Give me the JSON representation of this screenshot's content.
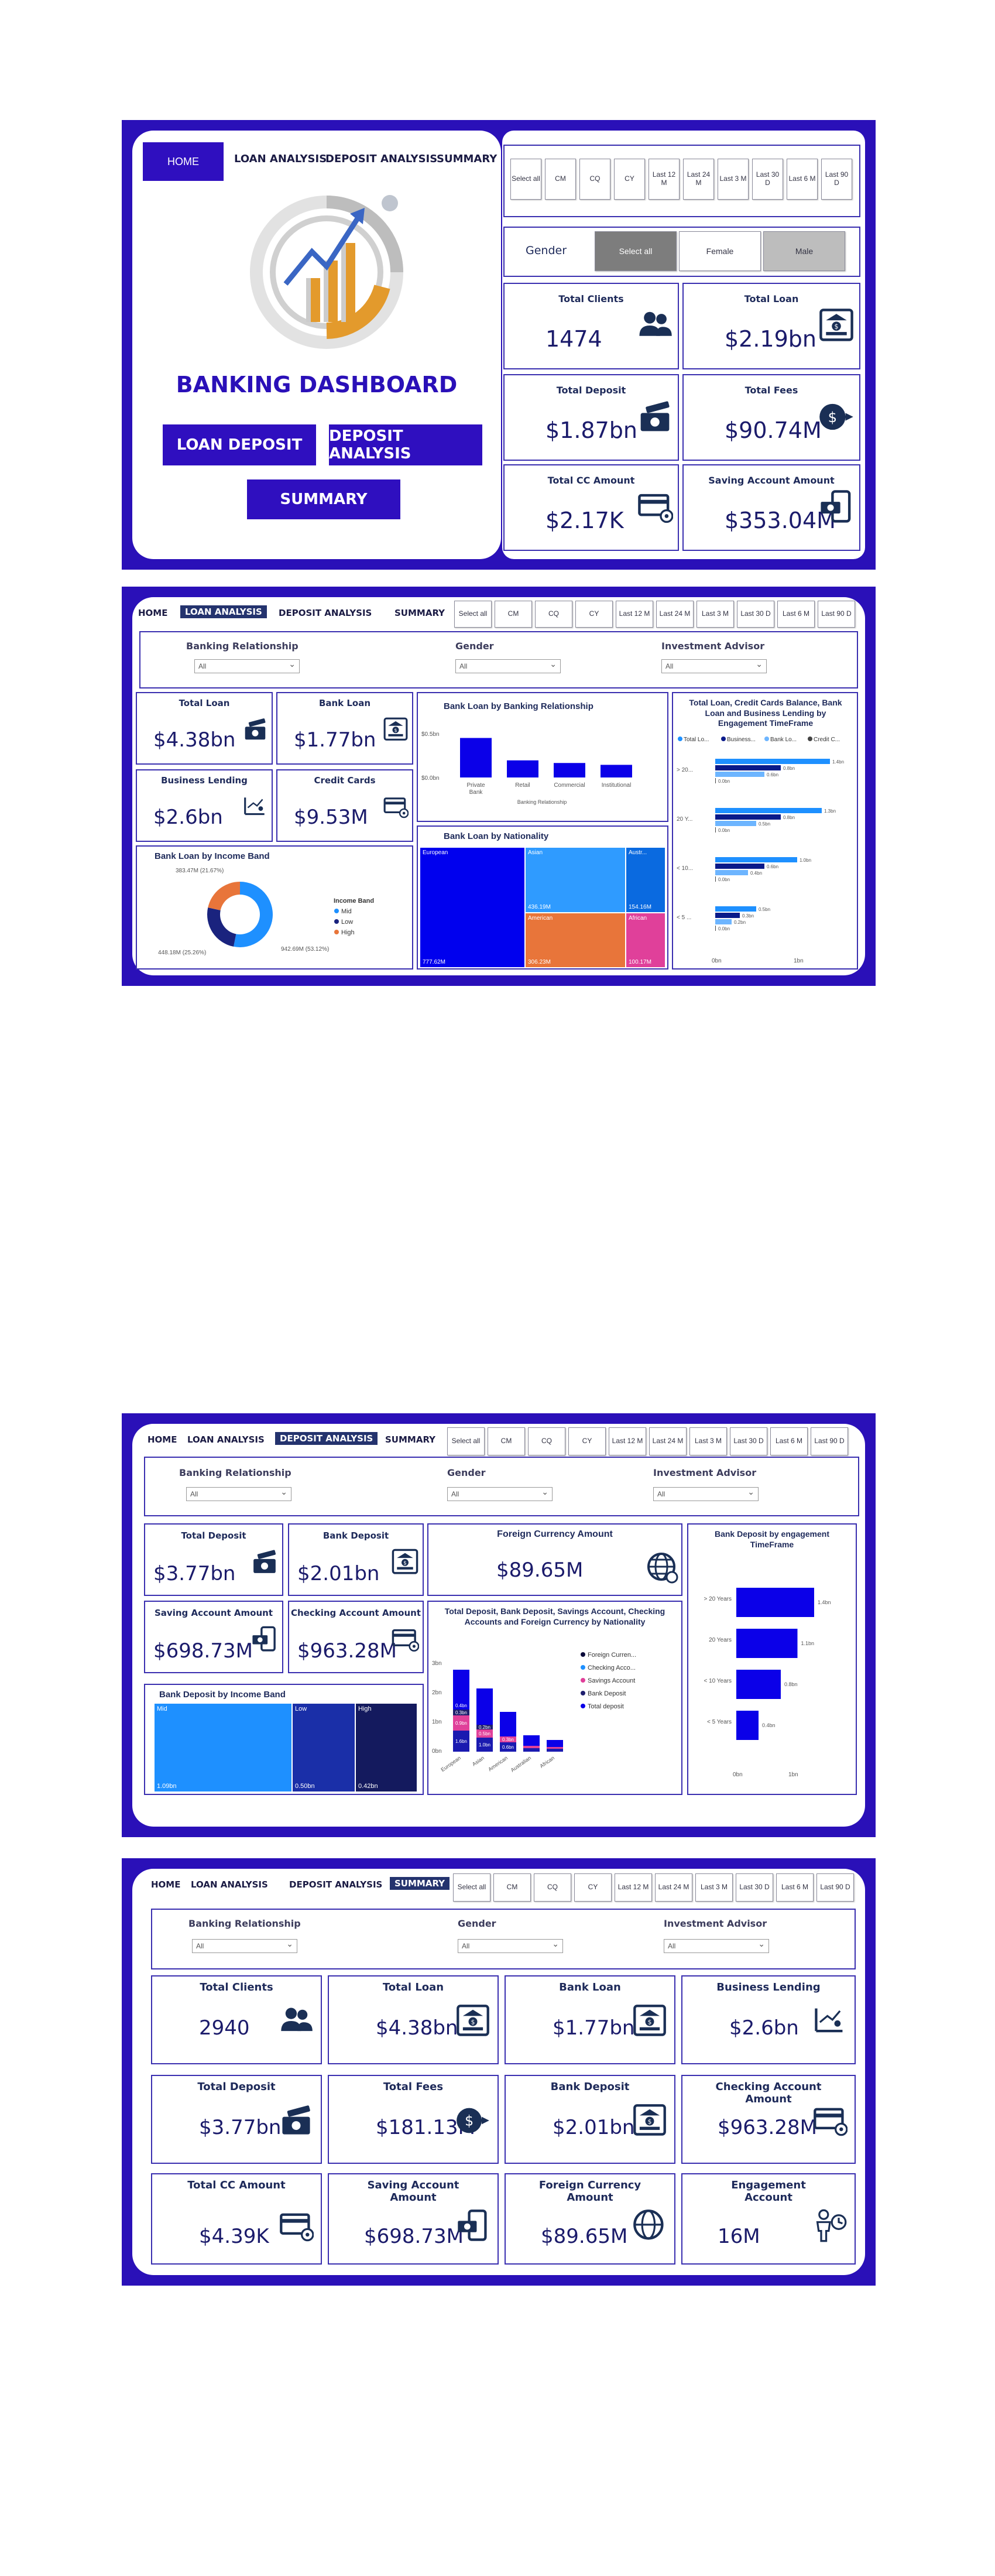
{
  "nav": {
    "home": "HOME",
    "loan": "LOAN ANALYSIS",
    "deposit": "DEPOSIT ANALYSIS",
    "summary": "SUMMARY"
  },
  "time_buttons": [
    "Select all",
    "CM",
    "CQ",
    "CY",
    "Last 12 M",
    "Last 24 M",
    "Last 3 M",
    "Last 30 D",
    "Last 6 M",
    "Last 90 D"
  ],
  "slicers": {
    "banking_relationship": "Banking Relationship",
    "gender": "Gender",
    "investment_advisor": "Investment Advisor",
    "all": "All"
  },
  "home": {
    "title": "BANKING DASHBOARD",
    "buttons": {
      "loan_deposit": "LOAN DEPOSIT",
      "deposit_analysis": "DEPOSIT ANALYSIS",
      "summary": "SUMMARY"
    },
    "gender": {
      "label": "Gender",
      "options": [
        "Select all",
        "Female",
        "Male"
      ]
    },
    "kpis": [
      {
        "title": "Total Clients",
        "value": "1474",
        "icon": "people-icon"
      },
      {
        "title": "Total Loan",
        "value": "$2.19bn",
        "icon": "bank-icon"
      },
      {
        "title": "Total Deposit",
        "value": "$1.87bn",
        "icon": "cash-icon"
      },
      {
        "title": "Total Fees",
        "value": "$90.74M",
        "icon": "dollar-arrow-icon"
      },
      {
        "title": "Total CC Amount",
        "value": "$2.17K",
        "icon": "credit-card-icon"
      },
      {
        "title": "Saving Account Amount",
        "value": "$353.04M",
        "icon": "savings-phone-icon"
      }
    ]
  },
  "loan": {
    "kpis": [
      {
        "title": "Total Loan",
        "value": "$4.38bn"
      },
      {
        "title": "Bank Loan",
        "value": "$1.77bn"
      },
      {
        "title": "Business Lending",
        "value": "$2.6bn"
      },
      {
        "title": "Credit Cards",
        "value": "$9.53M"
      }
    ],
    "income_band": {
      "title": "Bank Loan by Income Band",
      "legend_title": "Income Band",
      "labels": [
        "Mid",
        "Low",
        "High"
      ],
      "annotations": [
        "383.47M (21.67%)",
        "448.18M (25.26%)",
        "942.69M (53.12%)"
      ],
      "colors": [
        "#1e90ff",
        "#1a237e",
        "#e8753a"
      ],
      "values": [
        942.69,
        448.18,
        383.47
      ]
    },
    "relationship": {
      "title": "Bank Loan by  Banking Relationship",
      "categories": [
        "Private Bank",
        "Retail",
        "Commercial",
        "Institutional"
      ],
      "values": [
        1.5,
        0.65,
        0.55,
        0.48
      ],
      "ticks": [
        "$1.0bn",
        "$0.5bn",
        "$0.0bn"
      ],
      "xlabel": "Banking Relationship"
    },
    "nationality": {
      "title": "Bank Loan by  Nationality",
      "tiles": [
        {
          "name": "European",
          "value": "777.62M",
          "color": "#0000ee"
        },
        {
          "name": "Asian",
          "value": "436.19M",
          "color": "#2f9bff"
        },
        {
          "name": "Austr...",
          "value": "154.16M",
          "color": "#0a6ae0"
        },
        {
          "name": "American",
          "value": "306.23M",
          "color": "#e8753a"
        },
        {
          "name": "African",
          "value": "100.17M",
          "color": "#e0409a"
        }
      ]
    },
    "timeframe": {
      "title": "Total Loan, Credit Cards Balance, Bank Loan and Business Lending by Engagement TimeFrame",
      "legend": [
        "Total Lo...",
        "Business...",
        "Bank Lo...",
        "Credit C..."
      ],
      "groups": [
        "> 20...",
        "20 Y...",
        "< 10...",
        "< 5 ..."
      ],
      "labels": [
        [
          "1.4bn",
          "0.8bn",
          "0.6bn",
          "0.0bn"
        ],
        [
          "1.3bn",
          "0.8bn",
          "0.5bn",
          "0.0bn"
        ],
        [
          "1.0bn",
          "0.6bn",
          "0.4bn",
          "0.0bn"
        ],
        [
          "0.5bn",
          "0.3bn",
          "0.2bn",
          "0.0bn"
        ]
      ],
      "values": [
        [
          1.4,
          0.8,
          0.6,
          0.0
        ],
        [
          1.3,
          0.8,
          0.5,
          0.0
        ],
        [
          1.0,
          0.6,
          0.4,
          0.0
        ],
        [
          0.5,
          0.3,
          0.2,
          0.0
        ]
      ],
      "axis": [
        "0bn",
        "1bn"
      ]
    }
  },
  "deposit": {
    "kpis": [
      {
        "title": "Total Deposit",
        "value": "$3.77bn"
      },
      {
        "title": "Bank Deposit",
        "value": "$2.01bn"
      },
      {
        "title": "Saving Account Amount",
        "value": "$698.73M"
      },
      {
        "title": "Checking Account Amount",
        "value": "$963.28M"
      }
    ],
    "fx": {
      "title": "Foreign Currency Amount",
      "value": "$89.65M"
    },
    "income_band": {
      "title": "Bank Deposit by Income Band",
      "tiles": [
        {
          "name": "Mid",
          "value": "1.09bn"
        },
        {
          "name": "Low",
          "value": "0.50bn"
        },
        {
          "name": "High",
          "value": "0.42bn"
        }
      ]
    },
    "stacked": {
      "title": "Total Deposit, Bank Deposit, Savings Account, Checking Accounts and Foreign Currency by Nationality",
      "legend": [
        "Foreign Curren...",
        "Checking Acco...",
        "Savings Account",
        "Bank Deposit",
        "Total deposit"
      ],
      "categories": [
        "European",
        "Asian",
        "American",
        "Australian",
        "African"
      ],
      "labels": [
        [
          "1.6bn",
          "0.9bn",
          "0.3bn",
          "0.4bn"
        ],
        [
          "1.0bn",
          "0.5bn",
          "0.2bn"
        ],
        [
          "0.6bn",
          "0.3bn"
        ],
        [
          "",
          ""
        ],
        [
          "",
          ""
        ]
      ],
      "ticks": [
        "3bn",
        "2bn",
        "1bn",
        "0bn"
      ]
    },
    "timeframe": {
      "title": "Bank Deposit by engagement TimeFrame",
      "categories": [
        "> 20 Years",
        "20 Years",
        "< 10 Years",
        "< 5 Years"
      ],
      "values": [
        1.4,
        1.1,
        0.8,
        0.4
      ],
      "labels": [
        "1.4bn",
        "1.1bn",
        "0.8bn",
        "0.4bn"
      ],
      "axis": [
        "0bn",
        "1bn"
      ]
    }
  },
  "summary": {
    "kpis": [
      {
        "title": "Total Clients",
        "value": "2940",
        "icon": "people-icon"
      },
      {
        "title": "Total Loan",
        "value": "$4.38bn",
        "icon": "bank-icon"
      },
      {
        "title": "Bank Loan",
        "value": "$1.77bn",
        "icon": "bank-icon"
      },
      {
        "title": "Business Lending",
        "value": "$2.6bn",
        "icon": "chart-person-icon"
      },
      {
        "title": "Total Deposit",
        "value": "$3.77bn",
        "icon": "cash-icon"
      },
      {
        "title": "Total Fees",
        "value": "$181.13M",
        "icon": "dollar-arrow-icon"
      },
      {
        "title": "Bank Deposit",
        "value": "$2.01bn",
        "icon": "bank-icon"
      },
      {
        "title": "Checking Account Amount",
        "value": "$963.28M",
        "icon": "credit-card-icon"
      },
      {
        "title": "Total CC Amount",
        "value": "$4.39K",
        "icon": "credit-card-icon"
      },
      {
        "title": "Saving Account Amount",
        "value": "$698.73M",
        "icon": "savings-phone-icon"
      },
      {
        "title": "Foreign Currency Amount",
        "value": "$89.65M",
        "icon": "globe-icon"
      },
      {
        "title": "Engagement Account",
        "value": "16M",
        "icon": "person-clock-icon"
      }
    ]
  }
}
